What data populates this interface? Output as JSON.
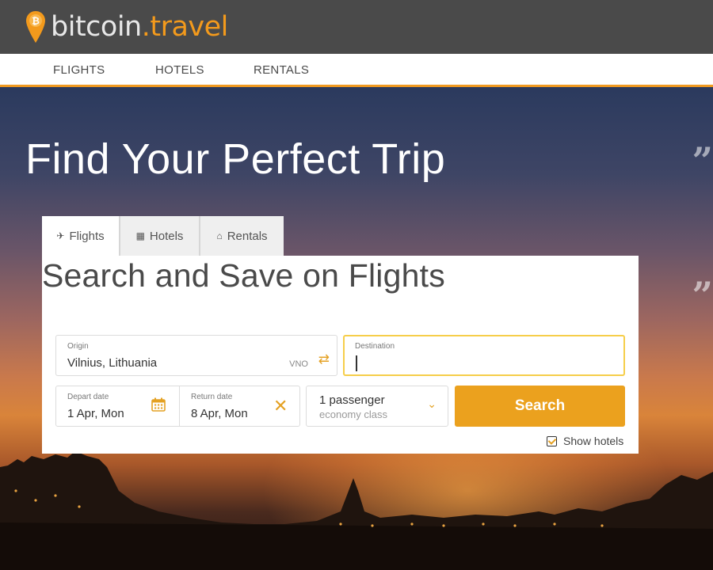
{
  "brand": {
    "name_part1": "bitcoin",
    "name_part2": ".travel",
    "accent": "#f39a1c"
  },
  "nav": {
    "items": [
      "FLIGHTS",
      "HOTELS",
      "RENTALS"
    ]
  },
  "hero": {
    "title": "Find Your Perfect Trip"
  },
  "tabs": [
    {
      "label": "Flights",
      "icon": "plane-icon",
      "active": true
    },
    {
      "label": "Hotels",
      "icon": "building-icon",
      "active": false
    },
    {
      "label": "Rentals",
      "icon": "home-icon",
      "active": false
    }
  ],
  "panel": {
    "title": "Search and Save on Flights"
  },
  "form": {
    "origin_label": "Origin",
    "origin_value": "Vilnius, Lithuania",
    "origin_code": "VNO",
    "destination_label": "Destination",
    "destination_value": "",
    "depart_label": "Depart date",
    "depart_value": "1 Apr, Mon",
    "return_label": "Return date",
    "return_value": "8 Apr, Mon",
    "passengers": "1 passenger",
    "cabin_class": "economy class",
    "search_label": "Search",
    "show_hotels_label": "Show hotels",
    "show_hotels_checked": true
  },
  "colors": {
    "search_button": "#eba11e",
    "destination_focus": "#f6ce4a",
    "nav_underline": "#f19a20"
  }
}
